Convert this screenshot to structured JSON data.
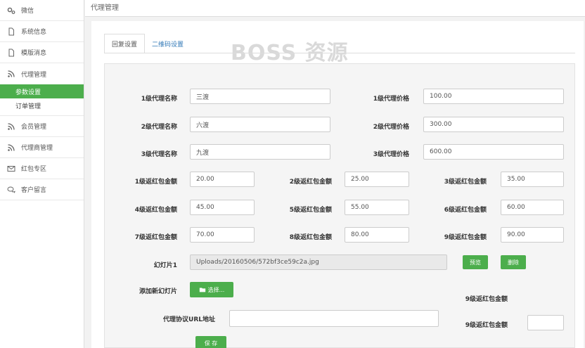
{
  "header": {
    "title": "代理管理"
  },
  "sidebar": {
    "items": [
      {
        "label": "微信",
        "icon": "gears-icon"
      },
      {
        "label": "系统信息",
        "icon": "file-icon"
      },
      {
        "label": "模版消息",
        "icon": "file-icon"
      },
      {
        "label": "代理管理",
        "icon": "rss-icon"
      },
      {
        "label": "会员管理",
        "icon": "rss-icon"
      },
      {
        "label": "代理商管理",
        "icon": "rss-icon"
      },
      {
        "label": "红包专区",
        "icon": "envelope-icon"
      },
      {
        "label": "客户留言",
        "icon": "comments-icon"
      }
    ],
    "subitems": [
      {
        "label": "参数设置",
        "active": true
      },
      {
        "label": "订单管理",
        "active": false
      }
    ]
  },
  "tabs": [
    {
      "label": "回复设置",
      "active": true
    },
    {
      "label": "二维码设置",
      "active": false
    }
  ],
  "watermark": "BOSS 资源",
  "form": {
    "agent_name_1": {
      "label": "1级代理名称",
      "value": "三渡"
    },
    "agent_name_2": {
      "label": "2级代理名称",
      "value": "六渡"
    },
    "agent_name_3": {
      "label": "3级代理名称",
      "value": "九渡"
    },
    "agent_price_1": {
      "label": "1级代理价格",
      "value": "100.00"
    },
    "agent_price_2": {
      "label": "2级代理价格",
      "value": "300.00"
    },
    "agent_price_3": {
      "label": "3级代理价格",
      "value": "600.00"
    },
    "rebate": [
      {
        "label": "1级返红包金额",
        "value": "20.00"
      },
      {
        "label": "2级返红包金额",
        "value": "25.00"
      },
      {
        "label": "3级返红包金额",
        "value": "35.00"
      },
      {
        "label": "4级返红包金额",
        "value": "45.00"
      },
      {
        "label": "5级返红包金额",
        "value": "55.00"
      },
      {
        "label": "6级返红包金额",
        "value": "60.00"
      },
      {
        "label": "7级返红包金额",
        "value": "70.00"
      },
      {
        "label": "8级返红包金额",
        "value": "80.00"
      },
      {
        "label": "9级返红包金额",
        "value": "90.00"
      }
    ],
    "slide": {
      "label": "幻灯片1",
      "value": "Uploads/20160506/572bf3ce59c2a.jpg"
    },
    "preview_label": "预览",
    "delete_label": "删除",
    "add_slide": {
      "label": "添加新幻灯片",
      "button": "选择..."
    },
    "extra_rebate_label_a": "9级返红包金额",
    "extra_rebate_label_b": "9级返红包金额",
    "protocol_url": {
      "label": "代理协议URL地址",
      "value": ""
    },
    "save_label": "保 存"
  },
  "colors": {
    "accent": "#4cae4c",
    "link": "#337ab7"
  }
}
